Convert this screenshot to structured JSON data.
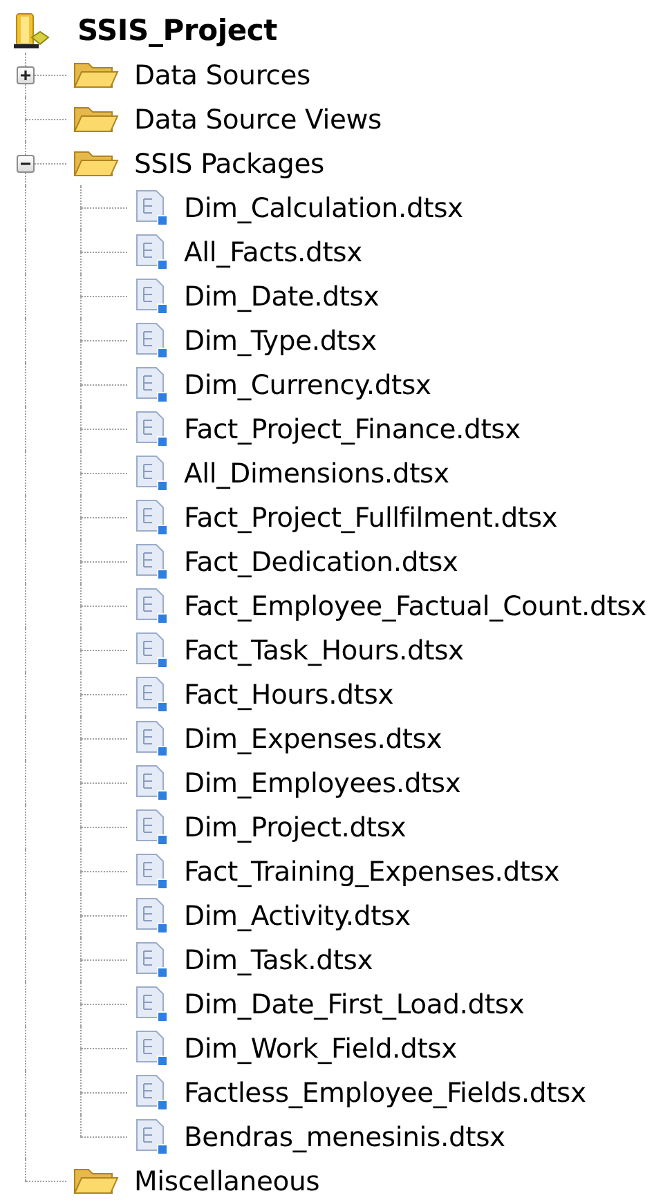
{
  "tree": {
    "label": "SSIS_Project",
    "children": [
      {
        "label": "Data Sources",
        "kind": "collapsed"
      },
      {
        "label": "Data Source Views",
        "kind": "empty"
      },
      {
        "label": "SSIS Packages",
        "kind": "expanded",
        "children": [
          {
            "label": "Dim_Calculation.dtsx"
          },
          {
            "label": "All_Facts.dtsx"
          },
          {
            "label": "Dim_Date.dtsx"
          },
          {
            "label": "Dim_Type.dtsx"
          },
          {
            "label": "Dim_Currency.dtsx"
          },
          {
            "label": "Fact_Project_Finance.dtsx"
          },
          {
            "label": "All_Dimensions.dtsx"
          },
          {
            "label": "Fact_Project_Fullfilment.dtsx"
          },
          {
            "label": "Fact_Dedication.dtsx"
          },
          {
            "label": "Fact_Employee_Factual_Count.dtsx"
          },
          {
            "label": "Fact_Task_Hours.dtsx"
          },
          {
            "label": "Fact_Hours.dtsx"
          },
          {
            "label": "Dim_Expenses.dtsx"
          },
          {
            "label": "Dim_Employees.dtsx"
          },
          {
            "label": "Dim_Project.dtsx"
          },
          {
            "label": "Fact_Training_Expenses.dtsx"
          },
          {
            "label": "Dim_Activity.dtsx"
          },
          {
            "label": "Dim_Task.dtsx"
          },
          {
            "label": "Dim_Date_First_Load.dtsx"
          },
          {
            "label": "Dim_Work_Field.dtsx"
          },
          {
            "label": "Factless_Employee_Fields.dtsx"
          },
          {
            "label": "Bendras_menesinis.dtsx"
          }
        ]
      },
      {
        "label": "Miscellaneous",
        "kind": "empty"
      }
    ]
  }
}
